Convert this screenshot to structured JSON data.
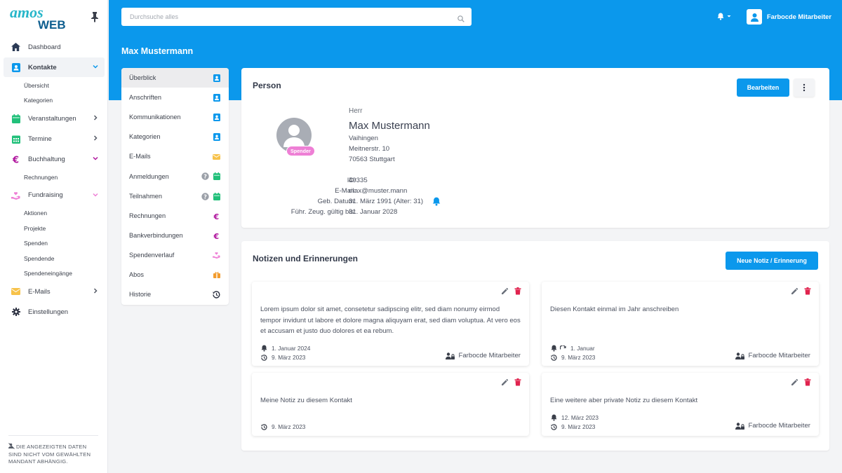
{
  "sidebar": {
    "logo_top": "amos",
    "logo_bottom": "WEB",
    "nav": [
      {
        "label": "Dashboard"
      },
      {
        "label": "Kontakte"
      },
      {
        "label": "Übersicht"
      },
      {
        "label": "Kategorien"
      },
      {
        "label": "Veranstaltungen"
      },
      {
        "label": "Termine"
      },
      {
        "label": "Buchhaltung"
      },
      {
        "label": "Rechnungen"
      },
      {
        "label": "Fundraising"
      },
      {
        "label": "Aktionen"
      },
      {
        "label": "Projekte"
      },
      {
        "label": "Spenden"
      },
      {
        "label": "Spendende"
      },
      {
        "label": "Spendeneingänge"
      },
      {
        "label": "E-Mails"
      },
      {
        "label": "Einstellungen"
      }
    ],
    "footer": "DIE ANGEZEIGTEN DATEN SIND NICHT VOM GEWÄHLTEN MANDANT ABHÄNGIG."
  },
  "header": {
    "search_placeholder": "Durchsuche alles",
    "user_name": "Farbocde Mitarbeiter",
    "page_title": "Max Mustermann"
  },
  "subnav": [
    {
      "label": "Überblick"
    },
    {
      "label": "Anschriften"
    },
    {
      "label": "Kommunikationen"
    },
    {
      "label": "Kategorien"
    },
    {
      "label": "E-Mails"
    },
    {
      "label": "Anmeldungen"
    },
    {
      "label": "Teilnahmen"
    },
    {
      "label": "Rechnungen"
    },
    {
      "label": "Bankverbindungen"
    },
    {
      "label": "Spendenverlauf"
    },
    {
      "label": "Abos"
    },
    {
      "label": "Historie"
    }
  ],
  "person": {
    "title": "Person",
    "edit_label": "Bearbeiten",
    "badge": "Spender",
    "salutation": "Herr",
    "name": "Max Mustermann",
    "address": [
      "Vaihingen",
      "Meitnerstr. 10",
      "70563 Stuttgart"
    ],
    "fields": [
      {
        "label": "ID:",
        "value": "49335"
      },
      {
        "label": "E-Mail:",
        "value": "max@muster.mann"
      },
      {
        "label": "Geb. Datum:",
        "value": "31. März 1991 (Alter: 31)"
      },
      {
        "label": "Führ. Zeug. gültig bis:",
        "value": "31. Januar 2028"
      }
    ]
  },
  "notes": {
    "title": "Notizen und Erinnerungen",
    "new_label": "Neue Notiz / Erinnerung",
    "items": [
      {
        "text": "Lorem ipsum dolor sit amet, consetetur sadipscing elitr, sed diam nonumy eirmod tempor invidunt ut labore et dolore magna aliquyam erat, sed diam voluptua. At vero eos et accusam et justo duo dolores et ea rebum.",
        "reminder": "1. Januar 2024",
        "created": "9. März 2023",
        "author": "Farbocde Mitarbeiter"
      },
      {
        "text": "Diesen Kontakt einmal im Jahr anschreiben",
        "reminder": "1. Januar",
        "created": "9. März 2023",
        "author": "Farbocde Mitarbeiter"
      },
      {
        "text": "Meine Notiz zu diesem Kontakt",
        "created": "9. März 2023"
      },
      {
        "text": "Eine weitere aber private Notiz zu diesem Kontakt",
        "reminder": "12. März 2023",
        "created": "9. März 2023",
        "author": "Farbocde Mitarbeiter"
      }
    ]
  },
  "colors": {
    "primary": "#0b98ec",
    "danger": "#e0234e",
    "green": "#21c07a",
    "purple": "#b0179e",
    "pink": "#ee7fd5",
    "orange": "#f29c2f",
    "yellow": "#f7c24a"
  }
}
